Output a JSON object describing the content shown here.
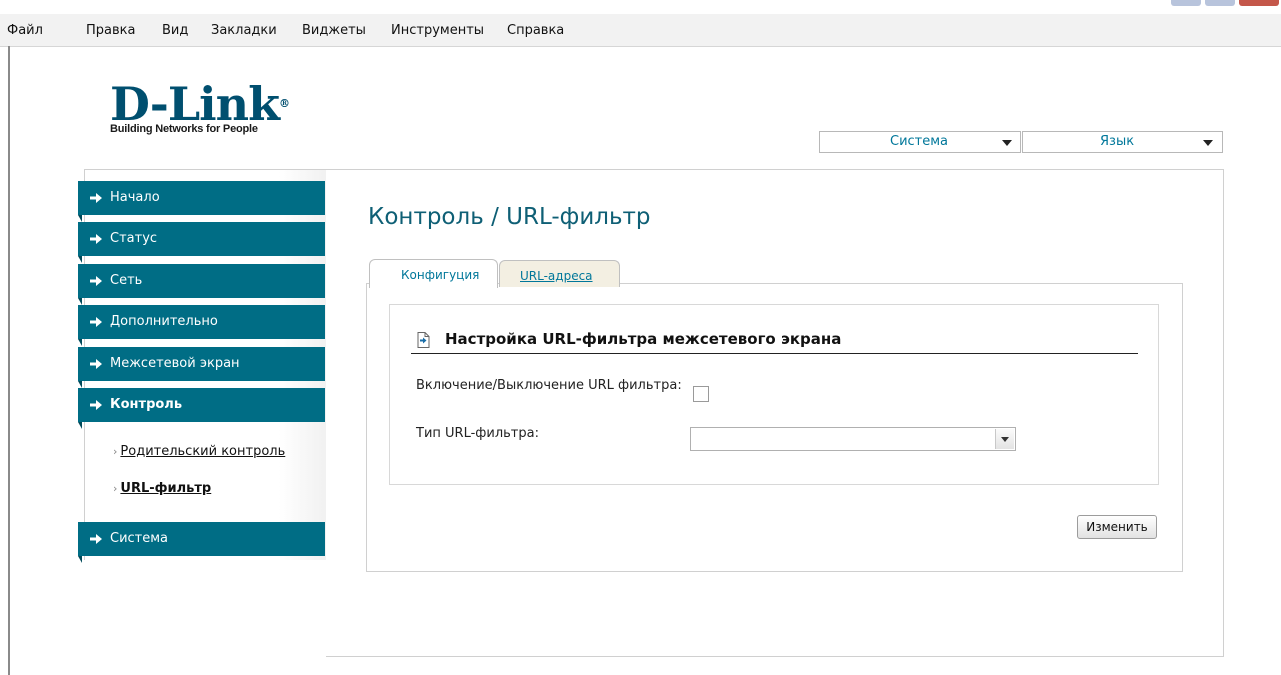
{
  "menu": [
    "Файл",
    "Правка",
    "Вид",
    "Закладки",
    "Виджеты",
    "Инструменты",
    "Справка"
  ],
  "logo": {
    "brand": "D-Link",
    "tagline": "Building Networks for People"
  },
  "top_selects": {
    "system": "Система",
    "language": "Язык"
  },
  "nav": {
    "items": [
      {
        "label": "Начало"
      },
      {
        "label": "Статус"
      },
      {
        "label": "Сеть"
      },
      {
        "label": "Дополнительно"
      },
      {
        "label": "Межсетевой экран"
      },
      {
        "label": "Контроль"
      },
      {
        "label": "Система"
      }
    ],
    "control_sub": [
      {
        "label": "Родительский контроль"
      },
      {
        "label": "URL-фильтр"
      }
    ]
  },
  "page": {
    "title": "Контроль / URL-фильтр",
    "tabs": [
      "Конфигуция",
      "URL-адреса"
    ],
    "section_title": "Настройка URL-фильтра межсетевого экрана",
    "enable_label": "Включение/Выключение URL фильтра:",
    "type_label": "Тип URL-фильтра:",
    "type_value": "",
    "change_button": "Изменить"
  },
  "colors": {
    "nav_bg": "#006d85",
    "accent_text": "#00779a",
    "title": "#0e5f75"
  }
}
